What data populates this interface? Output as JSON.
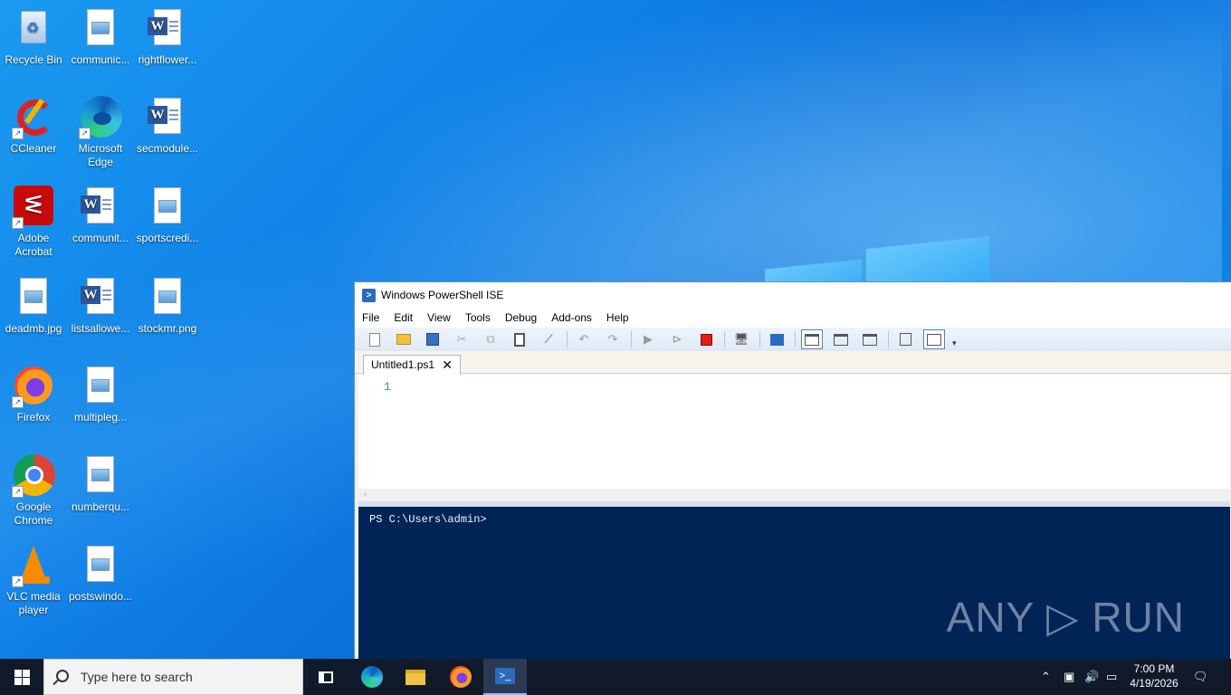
{
  "desktop": {
    "icons": [
      {
        "label": "Recycle Bin"
      },
      {
        "label": "communic..."
      },
      {
        "label": "rightflower..."
      },
      {
        "label": "CCleaner"
      },
      {
        "label": "Microsoft Edge"
      },
      {
        "label": "secmodule..."
      },
      {
        "label": "Adobe Acrobat"
      },
      {
        "label": "communit..."
      },
      {
        "label": "sportscredi..."
      },
      {
        "label": "deadmb.jpg"
      },
      {
        "label": "listsallowe..."
      },
      {
        "label": "stockmr.png"
      },
      {
        "label": "Firefox"
      },
      {
        "label": "multipleg..."
      },
      {
        "label": "Google Chrome"
      },
      {
        "label": "numberqu..."
      },
      {
        "label": "VLC media player"
      },
      {
        "label": "postswindo..."
      }
    ]
  },
  "window": {
    "title": "Windows PowerShell ISE",
    "menu": [
      "File",
      "Edit",
      "View",
      "Tools",
      "Debug",
      "Add-ons",
      "Help"
    ],
    "tab_label": "Untitled1.ps1",
    "tab_close": "✕",
    "line_number": "1",
    "scroll_glyph": "‹",
    "console_prompt": "PS C:\\Users\\admin>",
    "watermark": "ANY ▷ RUN"
  },
  "taskbar": {
    "search_placeholder": "Type here to search",
    "time": "7:00 PM",
    "date": "4/19/2026"
  }
}
